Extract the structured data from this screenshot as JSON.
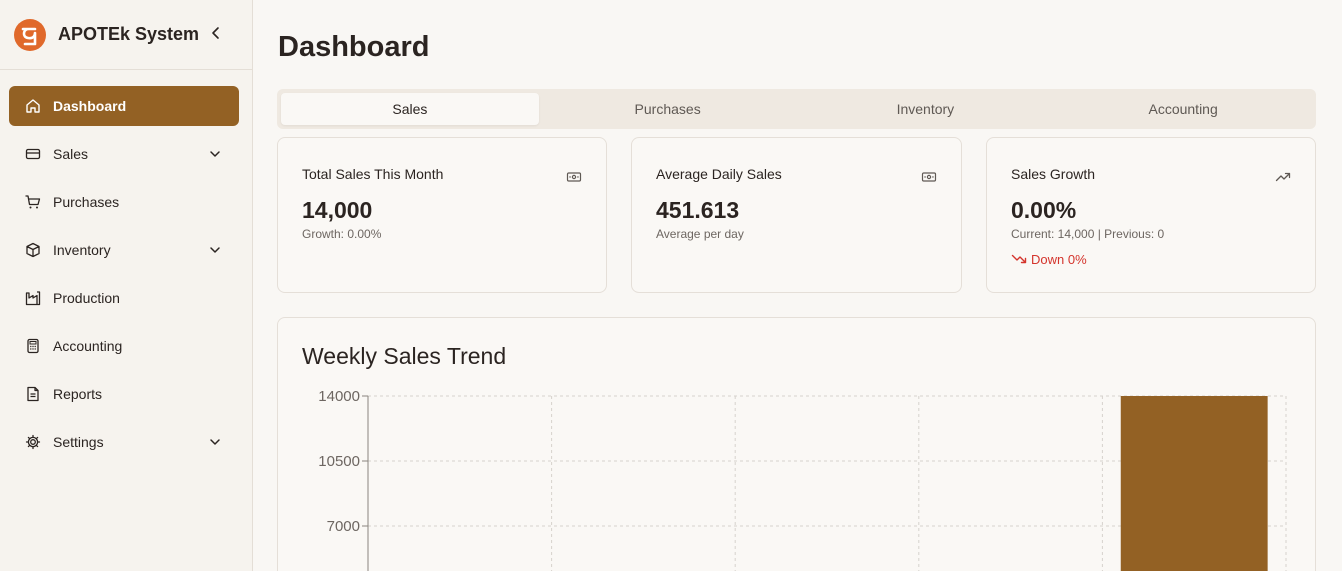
{
  "app": {
    "name": "APOTEk System"
  },
  "sidebar": {
    "items": [
      {
        "label": "Dashboard",
        "icon": "home-icon",
        "active": true,
        "has_children": false
      },
      {
        "label": "Sales",
        "icon": "credit-card-icon",
        "active": false,
        "has_children": true
      },
      {
        "label": "Purchases",
        "icon": "cart-icon",
        "active": false,
        "has_children": false
      },
      {
        "label": "Inventory",
        "icon": "package-icon",
        "active": false,
        "has_children": true
      },
      {
        "label": "Production",
        "icon": "factory-icon",
        "active": false,
        "has_children": false
      },
      {
        "label": "Accounting",
        "icon": "calculator-icon",
        "active": false,
        "has_children": false
      },
      {
        "label": "Reports",
        "icon": "file-text-icon",
        "active": false,
        "has_children": false
      },
      {
        "label": "Settings",
        "icon": "gear-icon",
        "active": false,
        "has_children": true
      }
    ]
  },
  "page": {
    "title": "Dashboard"
  },
  "tabs": [
    {
      "label": "Sales",
      "active": true
    },
    {
      "label": "Purchases",
      "active": false
    },
    {
      "label": "Inventory",
      "active": false
    },
    {
      "label": "Accounting",
      "active": false
    }
  ],
  "cards": [
    {
      "title": "Total Sales This Month",
      "value": "14,000",
      "sub": "Growth: 0.00%",
      "icon": "banknote-icon"
    },
    {
      "title": "Average Daily Sales",
      "value": "451.613",
      "sub": "Average per day",
      "icon": "banknote-icon"
    },
    {
      "title": "Sales Growth",
      "value": "0.00%",
      "sub": "Current: 14,000 | Previous: 0",
      "trend": "Down 0%",
      "icon": "trending-up-icon",
      "trend_icon": "trending-down-icon"
    }
  ],
  "colors": {
    "accent": "#936124",
    "down": "#d4342c",
    "background": "#f9f7f4"
  },
  "chart": {
    "title": "Weekly Sales Trend",
    "chart_data": {
      "type": "bar",
      "title": "Weekly Sales Trend",
      "categories": [
        "",
        "",
        "",
        "",
        ""
      ],
      "values": [
        0,
        0,
        0,
        0,
        14000
      ],
      "ylim": [
        0,
        14000
      ],
      "yticks": [
        "14000",
        "10500",
        "7000"
      ],
      "grid": true,
      "color": "#936124"
    }
  }
}
